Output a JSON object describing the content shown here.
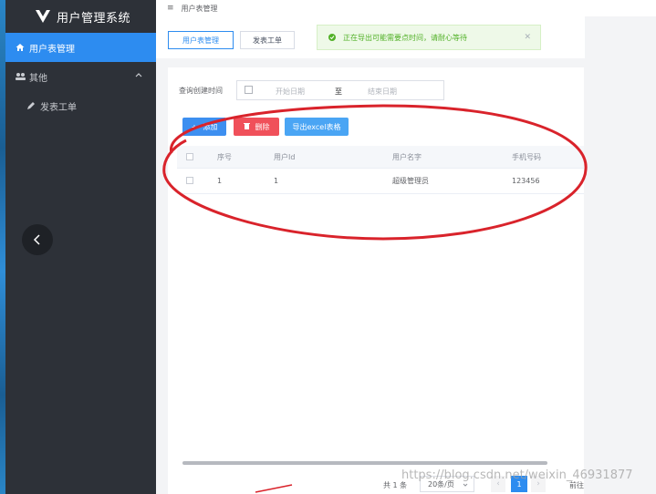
{
  "app": {
    "title": "用户管理系统"
  },
  "sidebar": {
    "items": [
      {
        "label": "用户表管理",
        "active": true,
        "icon": "home-icon"
      },
      {
        "label": "其他",
        "active": false,
        "icon": "group-icon",
        "expandable": true
      },
      {
        "label": "发表工单",
        "active": false,
        "icon": "pencil-icon"
      }
    ]
  },
  "breadcrumb": {
    "title": "用户表管理"
  },
  "tabs": [
    {
      "label": "用户表管理",
      "active": true
    },
    {
      "label": "发表工单",
      "active": false
    }
  ],
  "toast": {
    "message": "正在导出可能需要点时间，请耐心等待",
    "status_color": "#52b128"
  },
  "filter": {
    "label": "查询创建时间",
    "start_placeholder": "开始日期",
    "separator": "至",
    "end_placeholder": "结束日期"
  },
  "actions": {
    "add_label": "添加",
    "delete_label": "删除",
    "export_label": "导出excel表格"
  },
  "table": {
    "columns": [
      "序号",
      "用户Id",
      "用户名字",
      "手机号码"
    ],
    "rows": [
      [
        "1",
        "1",
        "超级管理员",
        "123456"
      ]
    ]
  },
  "pagination": {
    "total_text": "共 1 条",
    "page_size": "20条/页",
    "current_page": "1",
    "goto_text": "前往"
  },
  "watermark": "https://blog.csdn.net/weixin_46931877",
  "colors": {
    "primary": "#2d8cf0",
    "danger": "#f0505a",
    "sidebar_bg": "#2d3138",
    "annotation": "#d9232b"
  }
}
